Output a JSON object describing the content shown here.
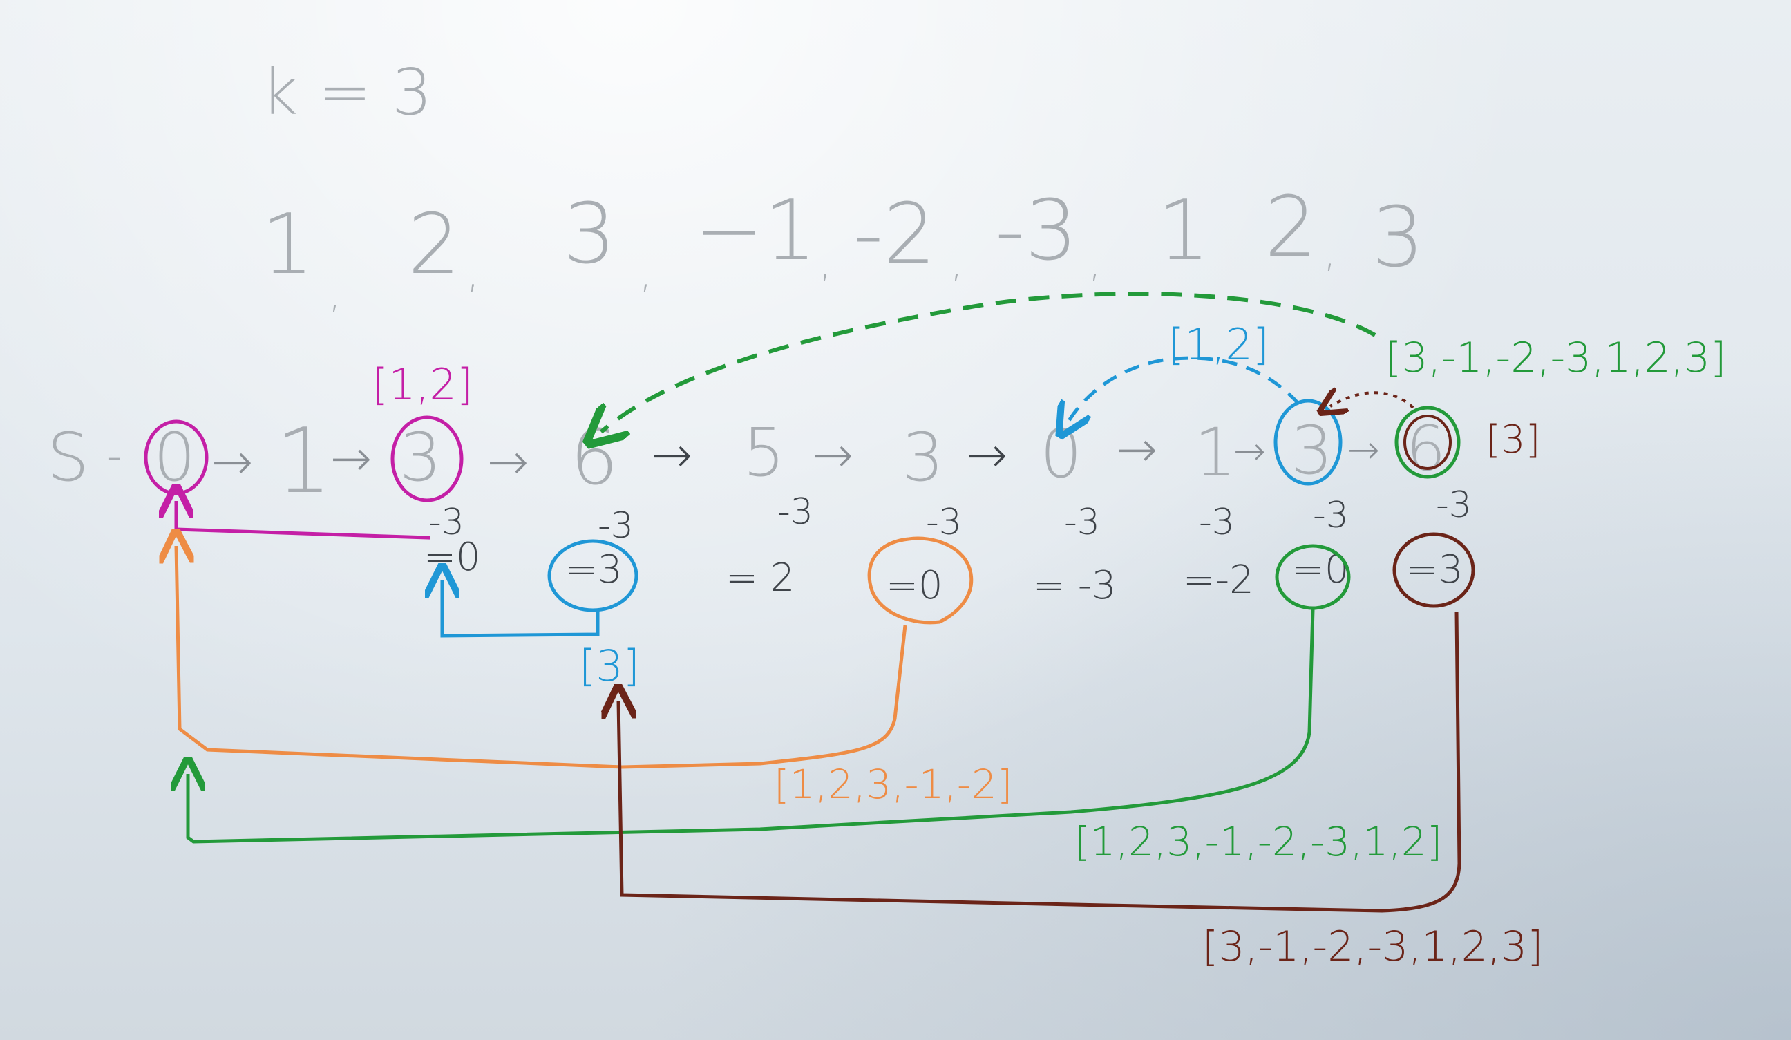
{
  "k_label": "k = 3",
  "array": {
    "values": [
      "1",
      "2",
      "3",
      "−1",
      "-2",
      "-3",
      "1",
      "2",
      "3"
    ],
    "commas": [
      ",",
      ",",
      ",",
      ",",
      ",",
      ",",
      ".",
      ","
    ]
  },
  "prefix_chain": {
    "start": "S",
    "dash": "-",
    "arrow": "→",
    "values": [
      "0",
      "1",
      "3",
      "6",
      "5",
      "3",
      "0",
      "1",
      "3",
      "6"
    ]
  },
  "minus_labels": [
    "-3",
    "-3",
    "-3",
    "-3",
    "-3",
    "-3",
    "-3",
    "-3"
  ],
  "remainders": [
    "=0",
    "=3",
    "= 2",
    "=0",
    "= -3",
    "=-2",
    "=0",
    "=3"
  ],
  "subarrays": {
    "magenta": "[1,2]",
    "blue_top": "[1,2]",
    "blue_bottom": "[3]",
    "dark_right": "[3]",
    "green_top": "[3,-1,-2,-3,1,2,3]",
    "orange": "[1,2,3,-1,-2]",
    "green_bottom": "[1,2,3,-1,-2,-3,1,2]",
    "brown": "[3,-1,-2,-3,1,2,3]"
  },
  "colors": {
    "magenta": "#c41fa6",
    "blue": "#1f97d6",
    "orange": "#ee8c45",
    "green": "#239a3a",
    "brown": "#6b2418",
    "marker_gray": "#8a8f95"
  }
}
